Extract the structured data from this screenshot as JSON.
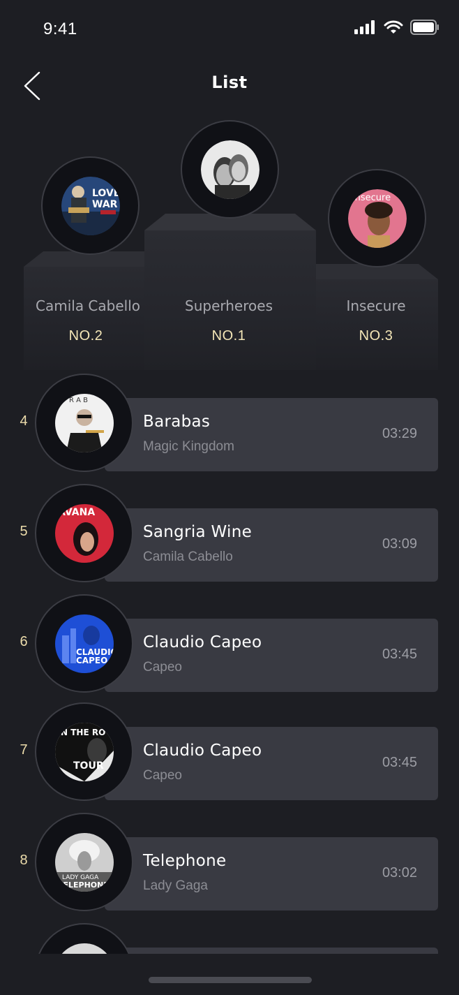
{
  "status_bar": {
    "time": "9:41"
  },
  "header": {
    "title": "List"
  },
  "podium": {
    "first": {
      "name": "Superheroes",
      "rank": "NO.1"
    },
    "second": {
      "name": "Camila Cabello",
      "rank": "NO.2"
    },
    "third": {
      "name": "Insecure",
      "rank": "NO.3"
    }
  },
  "tracks": [
    {
      "rank": "4",
      "title": "Barabas",
      "artist": "Magic Kingdom",
      "duration": "03:29"
    },
    {
      "rank": "5",
      "title": "Sangria Wine",
      "artist": "Camila Cabello",
      "duration": "03:09"
    },
    {
      "rank": "6",
      "title": "Claudio Capeo",
      "artist": "Capeo",
      "duration": "03:45"
    },
    {
      "rank": "7",
      "title": "Claudio Capeo",
      "artist": "Capeo",
      "duration": "03:45"
    },
    {
      "rank": "8",
      "title": "Telephone",
      "artist": "Lady Gaga",
      "duration": "03:02"
    }
  ],
  "colors": {
    "background": "#1d1e23",
    "card": "#393a42",
    "rank_accent": "#f4e6b7"
  }
}
